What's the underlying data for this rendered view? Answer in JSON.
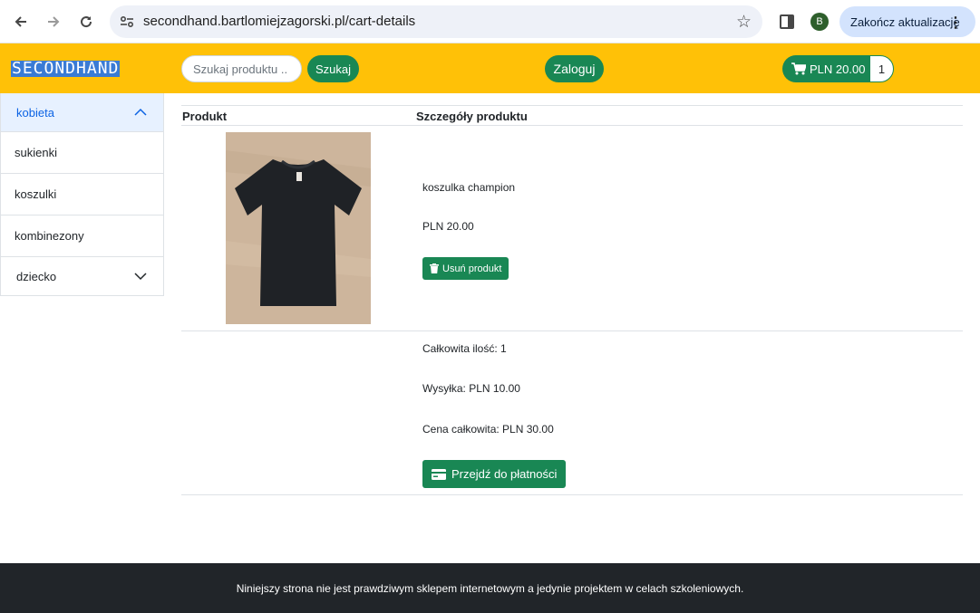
{
  "browser": {
    "url": "secondhand.bartlomiejzagorski.pl/cart-details",
    "profile_initial": "B",
    "update_label": "Zakończ aktualizację"
  },
  "header": {
    "logo": "SECONDHAND",
    "search_placeholder": "Szukaj produktu ..",
    "search_label": "Szukaj",
    "login_label": "Zaloguj",
    "cart_total": "PLN 20.00",
    "cart_count": "1"
  },
  "sidebar": {
    "sections": [
      {
        "label": "kobieta",
        "items": [
          "sukienki",
          "koszulki",
          "kombinezony"
        ]
      },
      {
        "label": "dziecko",
        "items": []
      }
    ]
  },
  "cart": {
    "columns": [
      "Produkt",
      "Szczegóły produktu"
    ],
    "item": {
      "name": "koszulka champion",
      "price": "PLN 20.00",
      "remove_label": "Usuń produkt",
      "brand_mark": "Champion"
    },
    "summary": {
      "quantity": "Całkowita ilość: 1",
      "shipping": "Wysyłka: PLN 10.00",
      "total": "Cena całkowita: PLN 30.00"
    },
    "checkout_label": "Przejdź do płatności"
  },
  "footer": {
    "text": "Niniejszy strona nie jest prawdziwym sklepem internetowym a jedynie projektem w celach szkoleniowych."
  },
  "colors": {
    "header_bg": "#ffc107",
    "button_green": "#198754",
    "footer_bg": "#212529",
    "accordion_active": "#e7f1ff"
  }
}
